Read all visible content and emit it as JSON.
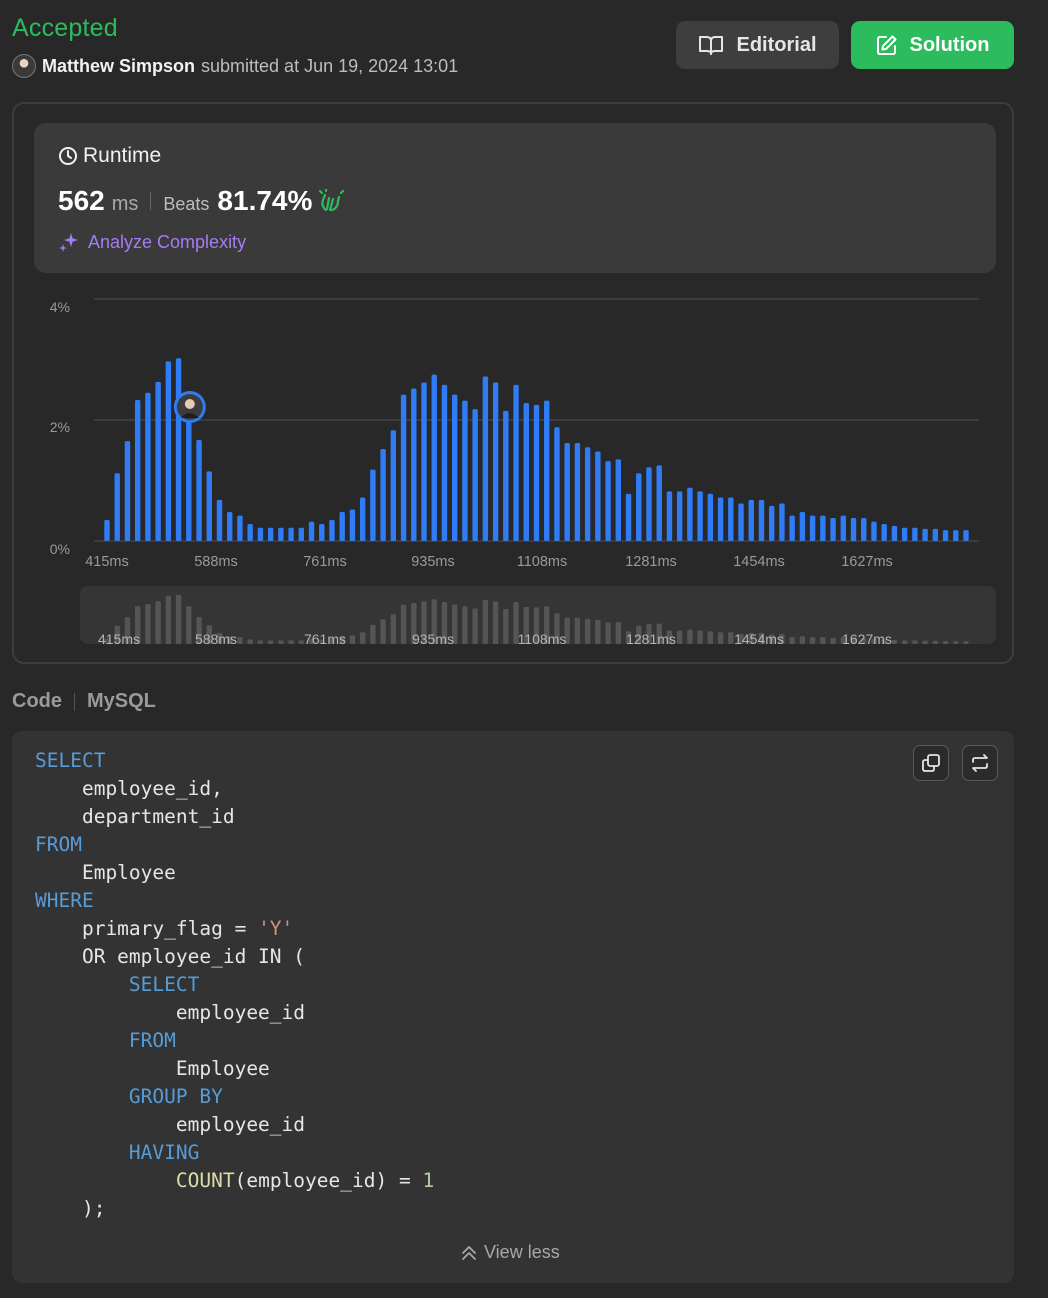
{
  "submission": {
    "status": "Accepted",
    "user": "Matthew Simpson",
    "submitted_text": "submitted at Jun 19, 2024 13:01"
  },
  "header_buttons": {
    "editorial": "Editorial",
    "solution": "Solution"
  },
  "colors": {
    "accepted": "#2cbb5d",
    "bar": "#2f7cf6",
    "analyze": "#a77bf3"
  },
  "runtime": {
    "title": "Runtime",
    "value": "562",
    "unit": "ms",
    "beats_label": "Beats",
    "beats_value": "81.74%",
    "analyze_label": "Analyze Complexity"
  },
  "chart_data": {
    "type": "bar",
    "ylabel": "",
    "xlabel": "",
    "y_ticks": [
      "4%",
      "2%",
      "0%"
    ],
    "ylim": [
      0,
      4
    ],
    "grid": true,
    "x_tick_labels": [
      "415ms",
      "588ms",
      "761ms",
      "935ms",
      "1108ms",
      "1281ms",
      "1454ms",
      "1627ms"
    ],
    "marker_bar_index": 8,
    "values": [
      0.35,
      1.12,
      1.65,
      2.33,
      2.45,
      2.63,
      2.97,
      3.02,
      2.32,
      1.67,
      1.15,
      0.68,
      0.48,
      0.42,
      0.28,
      0.22,
      0.22,
      0.22,
      0.22,
      0.22,
      0.32,
      0.28,
      0.35,
      0.48,
      0.52,
      0.72,
      1.18,
      1.52,
      1.83,
      2.42,
      2.52,
      2.62,
      2.75,
      2.58,
      2.42,
      2.32,
      2.18,
      2.72,
      2.62,
      2.15,
      2.58,
      2.28,
      2.25,
      2.32,
      1.88,
      1.62,
      1.62,
      1.55,
      1.48,
      1.32,
      1.35,
      0.78,
      1.12,
      1.22,
      1.25,
      0.82,
      0.82,
      0.88,
      0.82,
      0.78,
      0.72,
      0.72,
      0.62,
      0.68,
      0.68,
      0.58,
      0.62,
      0.42,
      0.48,
      0.42,
      0.42,
      0.38,
      0.42,
      0.38,
      0.38,
      0.32,
      0.28,
      0.25,
      0.22,
      0.22,
      0.2,
      0.2,
      0.18,
      0.18,
      0.18
    ]
  },
  "code_section": {
    "tab_code": "Code",
    "tab_language": "MySQL",
    "view_less": "View less",
    "lines": [
      [
        [
          "kw",
          "SELECT"
        ]
      ],
      [
        [
          "",
          "    employee_id,"
        ]
      ],
      [
        [
          "",
          "    department_id"
        ]
      ],
      [
        [
          "kw",
          "FROM"
        ]
      ],
      [
        [
          "",
          "    Employee"
        ]
      ],
      [
        [
          "kw",
          "WHERE"
        ]
      ],
      [
        [
          "",
          "    primary_flag = "
        ],
        [
          "str",
          "'Y'"
        ]
      ],
      [
        [
          "",
          "    OR employee_id IN ("
        ]
      ],
      [
        [
          "",
          "        "
        ],
        [
          "kw",
          "SELECT"
        ]
      ],
      [
        [
          "",
          "            employee_id"
        ]
      ],
      [
        [
          "",
          "        "
        ],
        [
          "kw",
          "FROM"
        ]
      ],
      [
        [
          "",
          "            Employee"
        ]
      ],
      [
        [
          "",
          "        "
        ],
        [
          "kw",
          "GROUP BY"
        ]
      ],
      [
        [
          "",
          "            employee_id"
        ]
      ],
      [
        [
          "",
          "        "
        ],
        [
          "kw",
          "HAVING"
        ]
      ],
      [
        [
          "",
          "            "
        ],
        [
          "fn",
          "COUNT"
        ],
        [
          "",
          "(employee_id) = "
        ],
        [
          "num",
          "1"
        ]
      ],
      [
        [
          "",
          "    );"
        ]
      ]
    ]
  }
}
